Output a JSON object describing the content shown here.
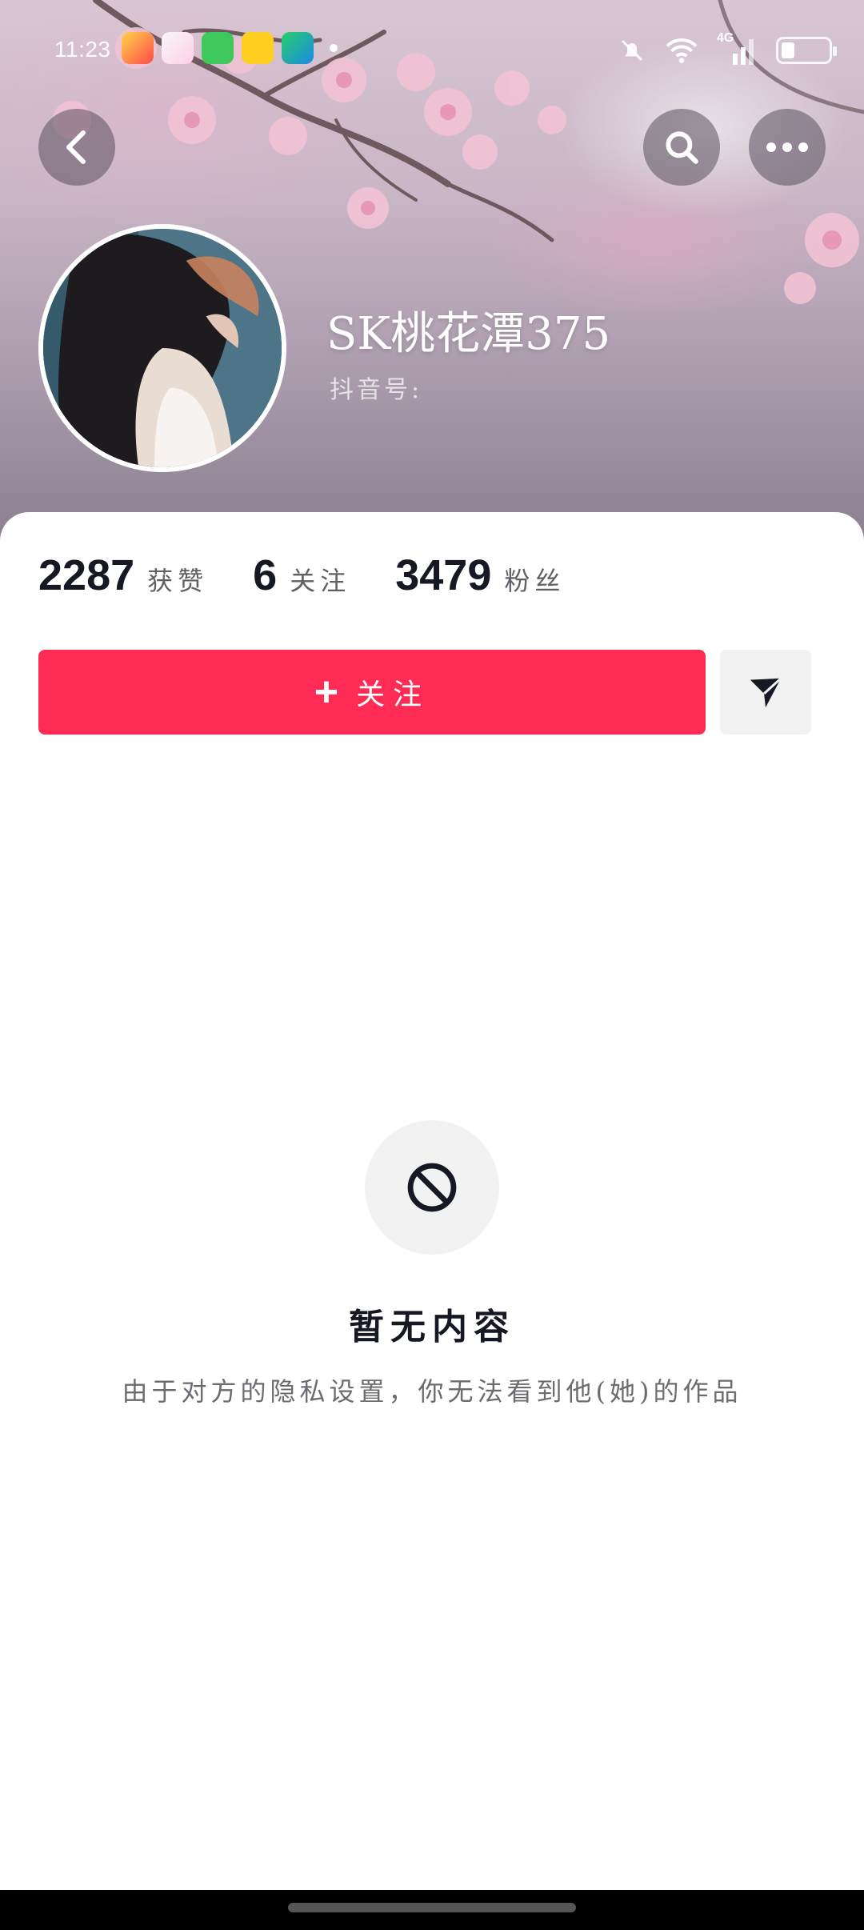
{
  "status_bar": {
    "time": "11:23",
    "network_label": "4G",
    "icons": [
      "notification-app-icon",
      "photo-app-icon",
      "message-app-icon",
      "game-app-icon",
      "video-app-icon",
      "silent-bell-icon",
      "wifi-icon",
      "signal-icon",
      "battery-icon"
    ]
  },
  "header": {
    "back_icon": "chevron-left-icon",
    "search_icon": "search-icon",
    "more_icon": "more-dots-icon"
  },
  "profile": {
    "name": "SK桃花潭375",
    "douyin_id_label": "抖音号:"
  },
  "stats": [
    {
      "value": "2287",
      "label": "获赞"
    },
    {
      "value": "6",
      "label": "关注"
    },
    {
      "value": "3479",
      "label": "粉丝"
    }
  ],
  "actions": {
    "follow_plus": "+",
    "follow_label": "关注",
    "message_icon": "send-icon"
  },
  "empty_state": {
    "icon": "forbidden-icon",
    "title": "暂无内容",
    "description": "由于对方的隐私设置，你无法看到他(她)的作品"
  },
  "colors": {
    "follow_button": "#fe2c55",
    "text_primary": "#161823",
    "text_secondary": "#6b6b72"
  }
}
